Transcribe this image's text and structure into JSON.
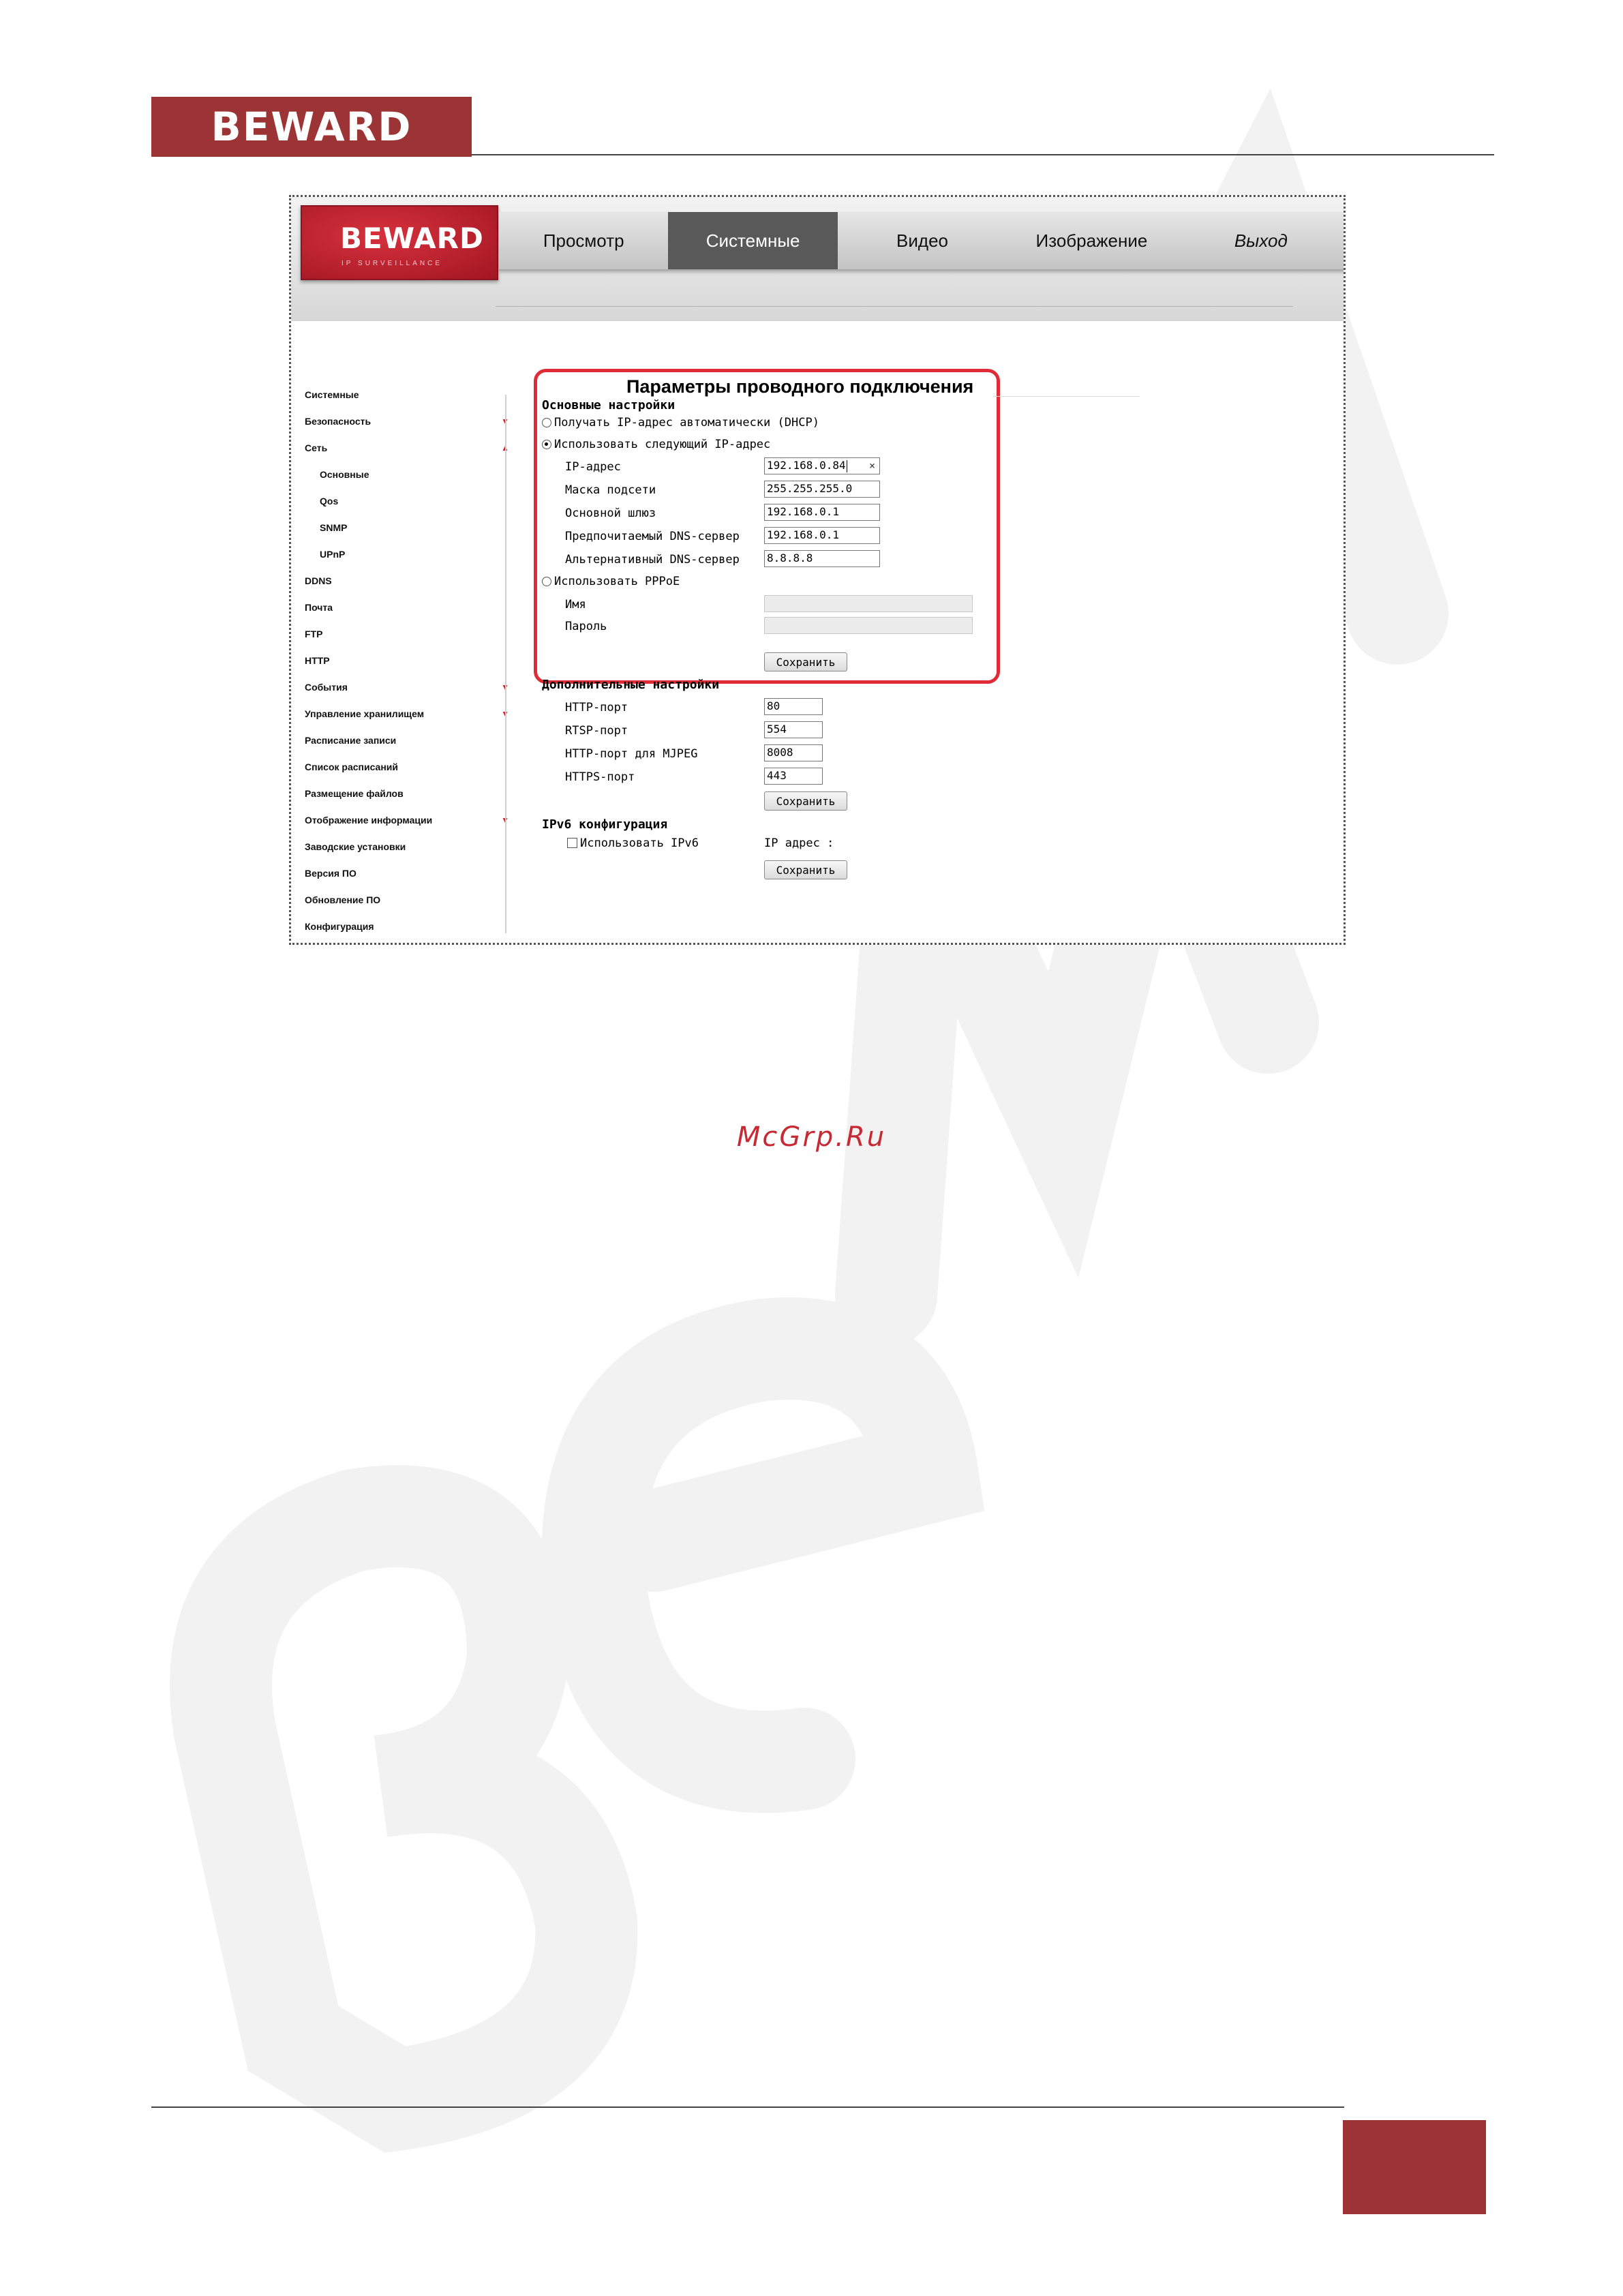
{
  "document": {
    "logo_text": "BEWARD",
    "footer_site": "McGrp.Ru"
  },
  "camera": {
    "logo": "BEWARD",
    "logo_tagline": "IP SURVEILLANCE"
  },
  "menu": [
    {
      "label": "Просмотр"
    },
    {
      "label": "Системные",
      "active": true
    },
    {
      "label": "Видео"
    },
    {
      "label": "Изображение"
    },
    {
      "label": "Выход"
    }
  ],
  "sidebar": [
    {
      "label": "Системные"
    },
    {
      "label": "Безопасность",
      "arrow": "down"
    },
    {
      "label": "Сеть",
      "arrow": "up"
    },
    {
      "label": "Основные",
      "sub": true
    },
    {
      "label": "Qos",
      "sub": true
    },
    {
      "label": "SNMP",
      "sub": true
    },
    {
      "label": "UPnP",
      "sub": true
    },
    {
      "label": "DDNS"
    },
    {
      "label": "Почта"
    },
    {
      "label": "FTP"
    },
    {
      "label": "HTTP"
    },
    {
      "label": "События",
      "arrow": "down"
    },
    {
      "label": "Управление хранилищем",
      "arrow": "down"
    },
    {
      "label": "Расписание записи"
    },
    {
      "label": "Список расписаний"
    },
    {
      "label": "Размещение файлов"
    },
    {
      "label": "Отображение информации",
      "arrow": "down"
    },
    {
      "label": "Заводские установки"
    },
    {
      "label": "Версия ПО"
    },
    {
      "label": "Обновление ПО"
    },
    {
      "label": "Конфигурация"
    }
  ],
  "arrows": {
    "down": "▼",
    "up": "▲"
  },
  "main": {
    "title": "Параметры проводного подключения",
    "basic": {
      "heading": "Основные настройки",
      "dhcp_label": "Получать IP-адрес автоматически (DHCP)",
      "static_label": "Использовать следующий IP-адрес",
      "ip_label": "IP-адрес",
      "ip_value": "192.168.0.84",
      "mask_label": "Маска подсети",
      "mask_value": "255.255.255.0",
      "gateway_label": "Основной шлюз",
      "gateway_value": "192.168.0.1",
      "dns1_label": "Предпочитаемый DNS-сервер",
      "dns1_value": "192.168.0.1",
      "dns2_label": "Альтернативный DNS-сервер",
      "dns2_value": "8.8.8.8",
      "pppoe_label": "Использовать PPPoE",
      "name_label": "Имя",
      "password_label": "Пароль",
      "save_label": "Сохранить",
      "clear_icon": "×"
    },
    "advanced": {
      "heading": "Дополнительные настройки",
      "http_label": "HTTP-порт",
      "http_value": "80",
      "rtsp_label": "RTSP-порт",
      "rtsp_value": "554",
      "mjpeg_label": "HTTP-порт для MJPEG",
      "mjpeg_value": "8008",
      "https_label": "HTTPS-порт",
      "https_value": "443",
      "save_label": "Сохранить"
    },
    "ipv6": {
      "heading": "IPv6 конфигурация",
      "use_label": "Использовать IPv6",
      "ip_label": "IP адрес :",
      "save_label": "Сохранить"
    }
  },
  "colors": {
    "brand": "#9c3436",
    "highlight": "#e02c36",
    "active_menu": "#595959"
  }
}
